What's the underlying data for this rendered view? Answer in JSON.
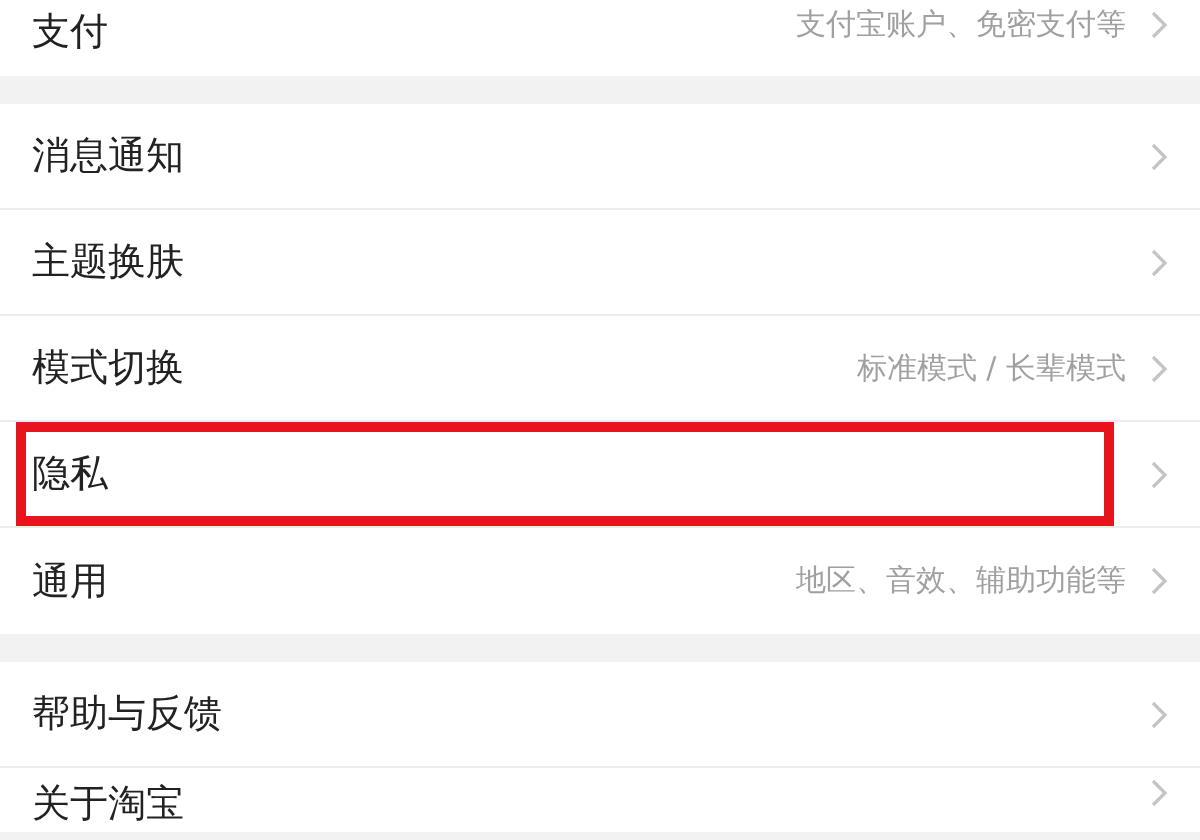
{
  "groups": [
    {
      "rows": [
        {
          "label": "支付",
          "value": "支付宝账户、免密支付等",
          "highlighted": false
        }
      ]
    },
    {
      "rows": [
        {
          "label": "消息通知",
          "highlighted": false
        },
        {
          "label": "主题换肤",
          "highlighted": false
        },
        {
          "label": "模式切换",
          "value": "标准模式 / 长辈模式",
          "highlighted": false
        },
        {
          "label": "隐私",
          "highlighted": true
        },
        {
          "label": "通用",
          "value": "地区、音效、辅助功能等",
          "highlighted": false
        }
      ]
    },
    {
      "rows": [
        {
          "label": "帮助与反馈",
          "highlighted": false
        },
        {
          "label": "关于淘宝",
          "highlighted": false
        }
      ]
    }
  ]
}
